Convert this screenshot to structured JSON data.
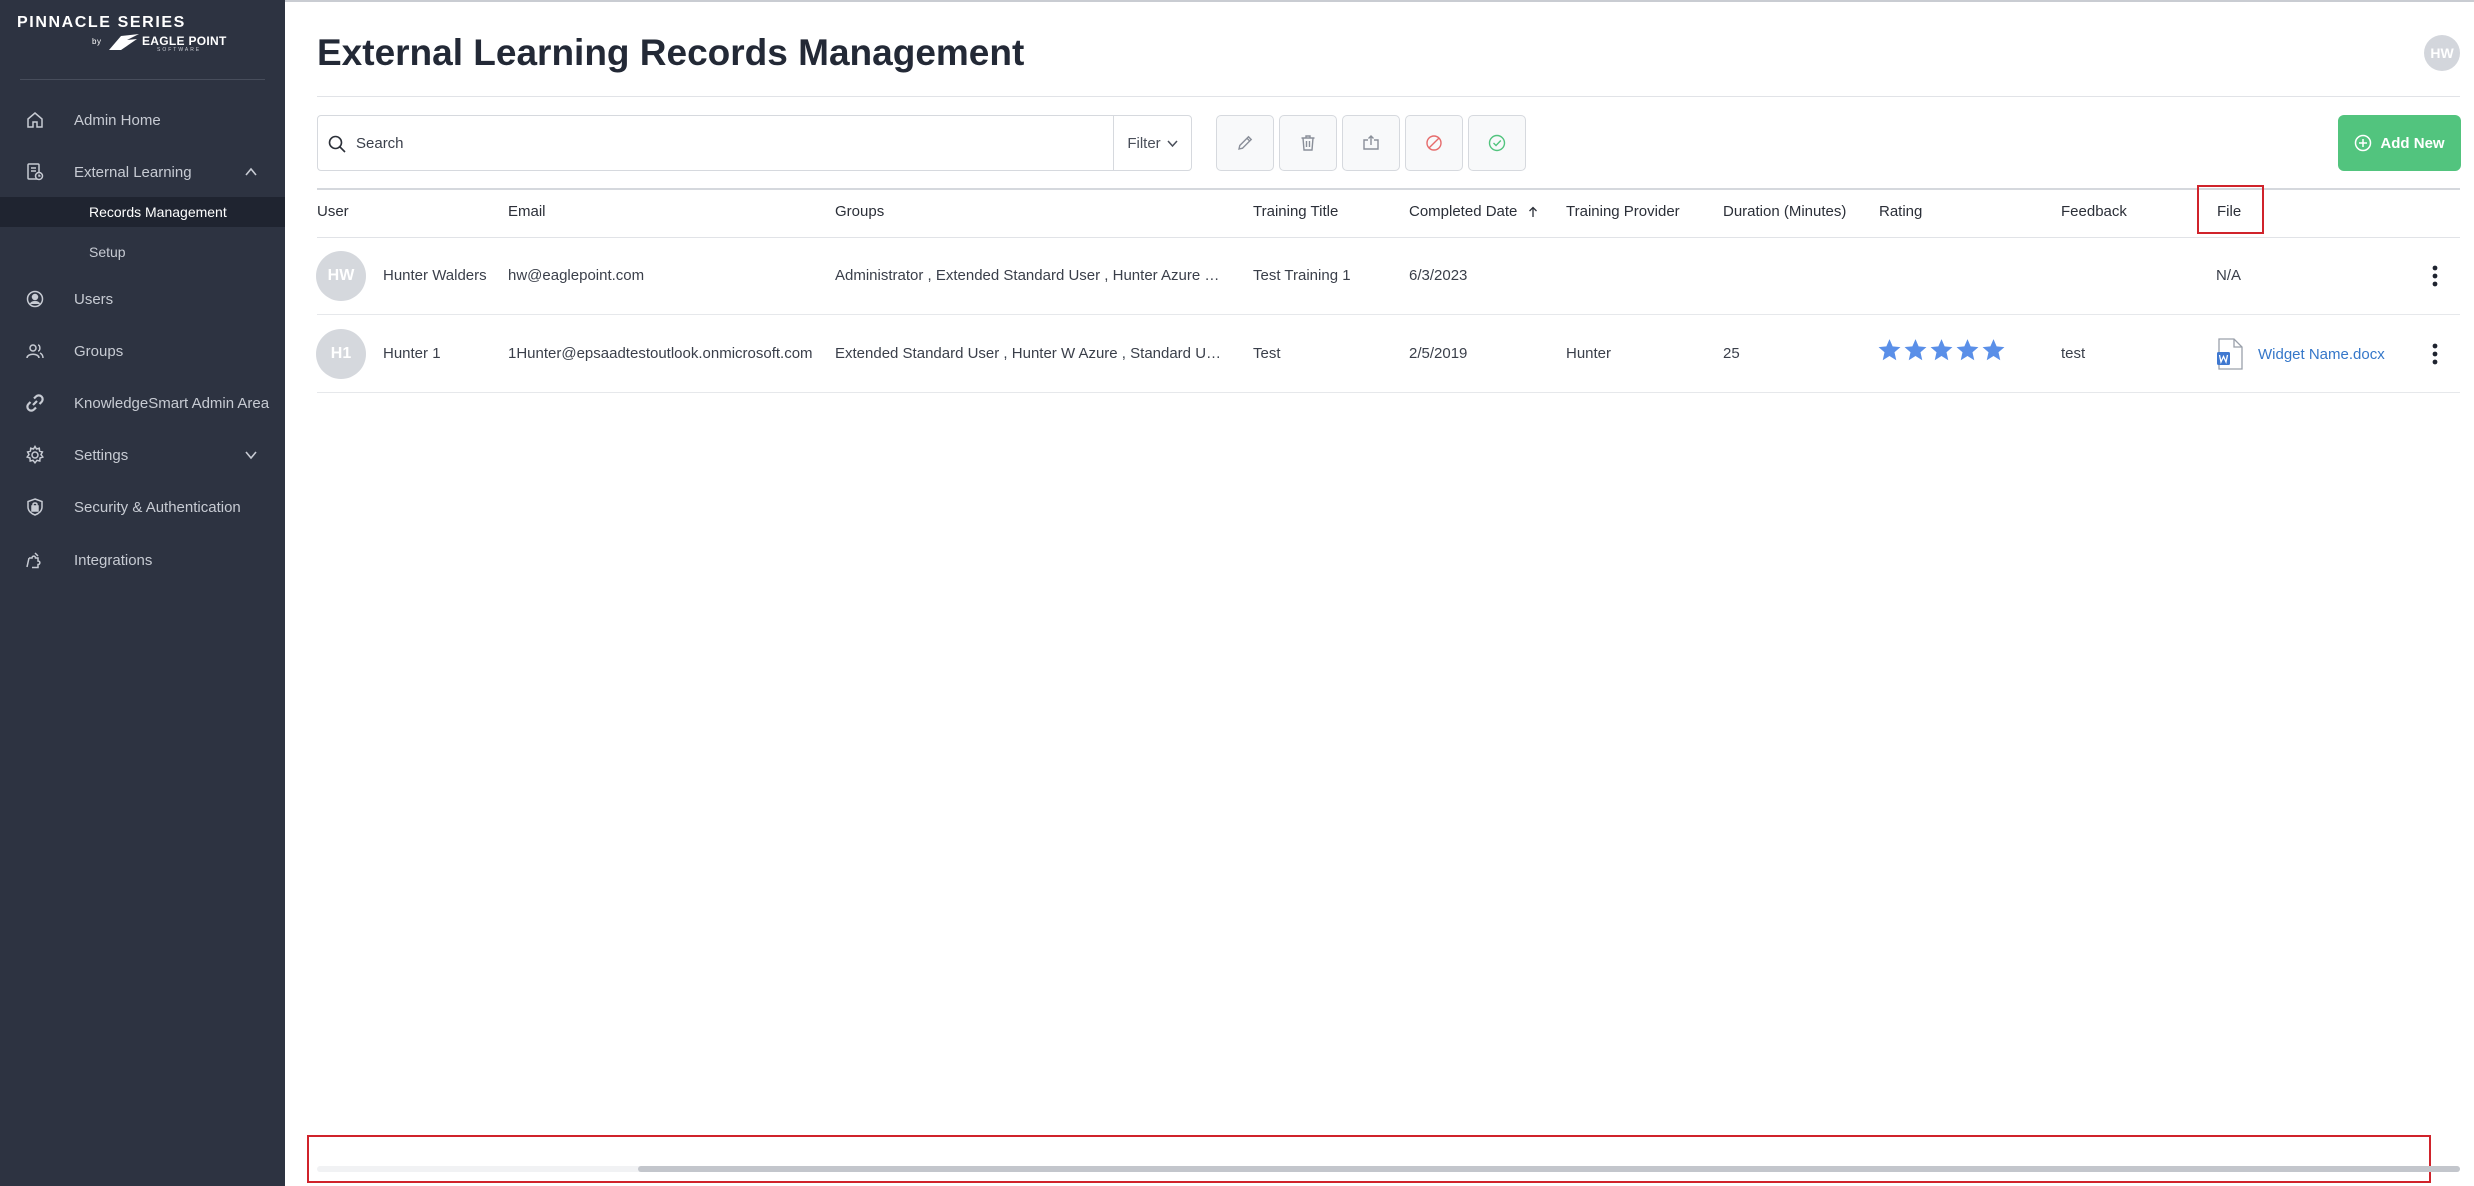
{
  "brand": {
    "product": "PINNACLE SERIES",
    "by": "by",
    "company": "EAGLE POINT",
    "company_sub": "SOFTWARE"
  },
  "sidebar": {
    "items": [
      {
        "label": "Admin Home",
        "icon": "home-icon"
      },
      {
        "label": "External Learning",
        "icon": "external-learning-icon",
        "expanded": true,
        "children": [
          {
            "label": "Records Management",
            "active": true
          },
          {
            "label": "Setup"
          }
        ]
      },
      {
        "label": "Users",
        "icon": "user-circle-icon"
      },
      {
        "label": "Groups",
        "icon": "groups-icon"
      },
      {
        "label": "KnowledgeSmart Admin Area",
        "icon": "link-icon"
      },
      {
        "label": "Settings",
        "icon": "gear-icon",
        "expanded": false
      },
      {
        "label": "Security & Authentication",
        "icon": "shield-lock-icon"
      },
      {
        "label": "Integrations",
        "icon": "puzzle-icon"
      }
    ]
  },
  "header": {
    "title": "External Learning Records Management",
    "user_initials": "HW"
  },
  "toolbar": {
    "search_placeholder": "Search",
    "filter_label": "Filter",
    "add_new_label": "Add New",
    "icons": [
      "edit-icon",
      "delete-icon",
      "export-icon",
      "deny-icon",
      "approve-icon"
    ]
  },
  "table": {
    "columns": [
      "User",
      "Email",
      "Groups",
      "Training Title",
      "Completed Date",
      "Training Provider",
      "Duration (Minutes)",
      "Rating",
      "Feedback",
      "File"
    ],
    "sort_column": "Completed Date",
    "sort_direction": "ascending",
    "rows": [
      {
        "initials": "HW",
        "user": "Hunter Walders",
        "email": "hw@eaglepoint.com",
        "groups": "Administrator , Extended Standard User , Hunter Azure Gro...",
        "training_title": "Test Training 1",
        "completed_date": "6/3/2023",
        "provider": "",
        "duration": "",
        "rating": 0,
        "feedback": "",
        "file": "N/A"
      },
      {
        "initials": "H1",
        "user": "Hunter 1",
        "email": "1Hunter@epsaadtestoutlook.onmicrosoft.com",
        "groups": "Extended Standard User , Hunter W Azure , Standard User",
        "training_title": "Test",
        "completed_date": "2/5/2019",
        "provider": "Hunter",
        "duration": "25",
        "rating": 5,
        "feedback": "test",
        "file": "Widget Name.docx"
      }
    ]
  },
  "scrollbar": {
    "horizontal_position": 0.15
  },
  "colors": {
    "sidebar_bg": "#2d3341",
    "active_item_bg": "#1f2430",
    "primary_green": "#52c47e",
    "star_blue": "#5a8fe8",
    "link_blue": "#3577c9",
    "annotation_red": "#d0232b"
  }
}
